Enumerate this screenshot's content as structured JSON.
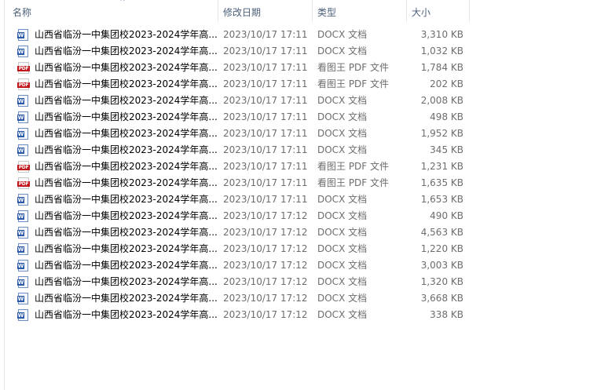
{
  "columns": {
    "name": "名称",
    "date": "修改日期",
    "type": "类型",
    "size": "大小"
  },
  "sort_indicator": "^",
  "files": [
    {
      "name": "山西省临汾一中集团校2023-2024学年高...",
      "date": "2023/10/17 17:11",
      "type": "DOCX 文档",
      "size": "3,310 KB",
      "icon": "docx-icon"
    },
    {
      "name": "山西省临汾一中集团校2023-2024学年高...",
      "date": "2023/10/17 17:11",
      "type": "DOCX 文档",
      "size": "1,032 KB",
      "icon": "docx-icon"
    },
    {
      "name": "山西省临汾一中集团校2023-2024学年高...",
      "date": "2023/10/17 17:11",
      "type": "看图王 PDF 文件",
      "size": "1,784 KB",
      "icon": "pdf-icon"
    },
    {
      "name": "山西省临汾一中集团校2023-2024学年高...",
      "date": "2023/10/17 17:11",
      "type": "看图王 PDF 文件",
      "size": "202 KB",
      "icon": "pdf-icon"
    },
    {
      "name": "山西省临汾一中集团校2023-2024学年高...",
      "date": "2023/10/17 17:11",
      "type": "DOCX 文档",
      "size": "2,008 KB",
      "icon": "docx-icon"
    },
    {
      "name": "山西省临汾一中集团校2023-2024学年高...",
      "date": "2023/10/17 17:11",
      "type": "DOCX 文档",
      "size": "498 KB",
      "icon": "docx-icon"
    },
    {
      "name": "山西省临汾一中集团校2023-2024学年高...",
      "date": "2023/10/17 17:11",
      "type": "DOCX 文档",
      "size": "1,952 KB",
      "icon": "docx-icon"
    },
    {
      "name": "山西省临汾一中集团校2023-2024学年高...",
      "date": "2023/10/17 17:11",
      "type": "DOCX 文档",
      "size": "345 KB",
      "icon": "docx-icon"
    },
    {
      "name": "山西省临汾一中集团校2023-2024学年高...",
      "date": "2023/10/17 17:11",
      "type": "看图王 PDF 文件",
      "size": "1,231 KB",
      "icon": "pdf-icon"
    },
    {
      "name": "山西省临汾一中集团校2023-2024学年高...",
      "date": "2023/10/17 17:11",
      "type": "看图王 PDF 文件",
      "size": "1,635 KB",
      "icon": "pdf-icon"
    },
    {
      "name": "山西省临汾一中集团校2023-2024学年高...",
      "date": "2023/10/17 17:11",
      "type": "DOCX 文档",
      "size": "1,653 KB",
      "icon": "docx-icon"
    },
    {
      "name": "山西省临汾一中集团校2023-2024学年高...",
      "date": "2023/10/17 17:12",
      "type": "DOCX 文档",
      "size": "490 KB",
      "icon": "docx-icon"
    },
    {
      "name": "山西省临汾一中集团校2023-2024学年高...",
      "date": "2023/10/17 17:12",
      "type": "DOCX 文档",
      "size": "4,563 KB",
      "icon": "docx-icon"
    },
    {
      "name": "山西省临汾一中集团校2023-2024学年高...",
      "date": "2023/10/17 17:12",
      "type": "DOCX 文档",
      "size": "1,220 KB",
      "icon": "docx-icon"
    },
    {
      "name": "山西省临汾一中集团校2023-2024学年高...",
      "date": "2023/10/17 17:12",
      "type": "DOCX 文档",
      "size": "3,003 KB",
      "icon": "docx-icon"
    },
    {
      "name": "山西省临汾一中集团校2023-2024学年高...",
      "date": "2023/10/17 17:12",
      "type": "DOCX 文档",
      "size": "1,320 KB",
      "icon": "docx-icon"
    },
    {
      "name": "山西省临汾一中集团校2023-2024学年高...",
      "date": "2023/10/17 17:12",
      "type": "DOCX 文档",
      "size": "3,668 KB",
      "icon": "docx-icon"
    },
    {
      "name": "山西省临汾一中集团校2023-2024学年高...",
      "date": "2023/10/17 17:12",
      "type": "DOCX 文档",
      "size": "338 KB",
      "icon": "docx-icon"
    }
  ],
  "icons": {
    "docx_label": "W",
    "pdf_label": "PDF"
  },
  "colors": {
    "header_text": "#4c607a",
    "docx_blue": "#2b5aa8",
    "pdf_red": "#c0171c"
  }
}
